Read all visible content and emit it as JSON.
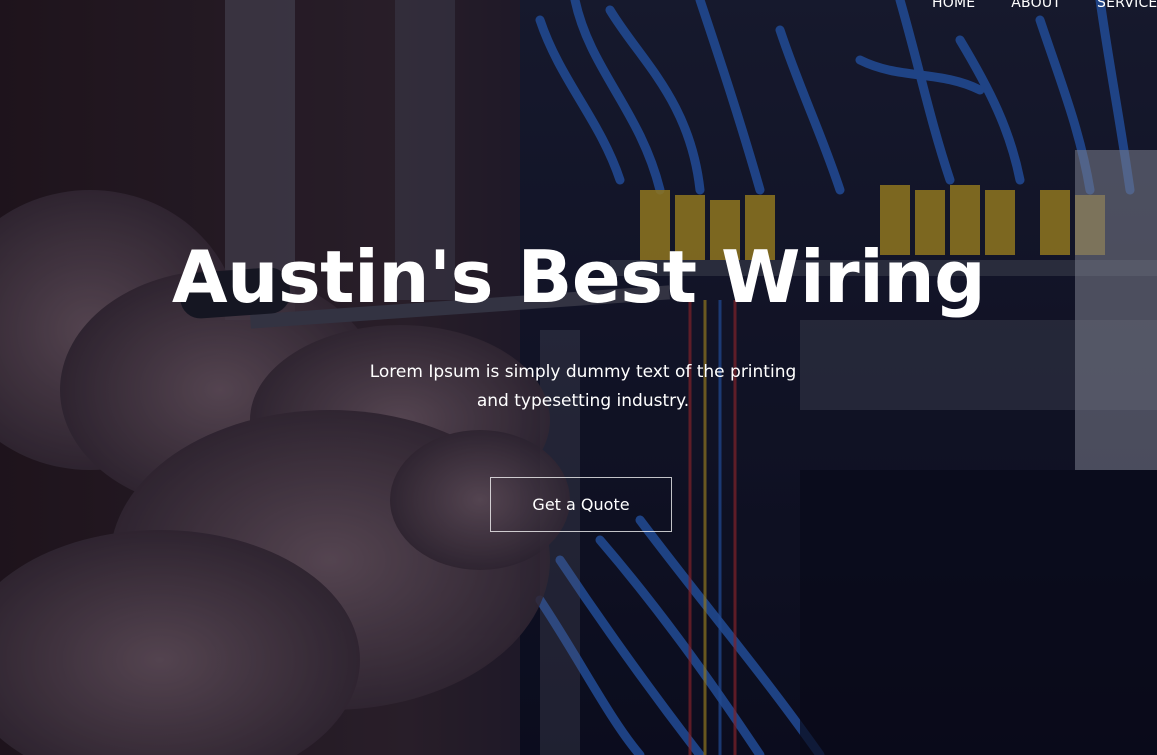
{
  "nav": {
    "items": [
      "HOME",
      "ABOUT",
      "SERVICES"
    ]
  },
  "hero": {
    "title": "Austin's Best Wiring",
    "subtitle": "Lorem Ipsum is simply dummy text of the printing and typesetting industry.",
    "cta_label": "Get a Quote",
    "background_image": "photo of hands working on an electrical panel with blue wires and yellow terminal blocks"
  },
  "colors": {
    "text": "#ffffff",
    "overlay": "#0b0d1c",
    "wire_blue": "#2f6fd6",
    "terminal_yellow": "#d8b020"
  }
}
